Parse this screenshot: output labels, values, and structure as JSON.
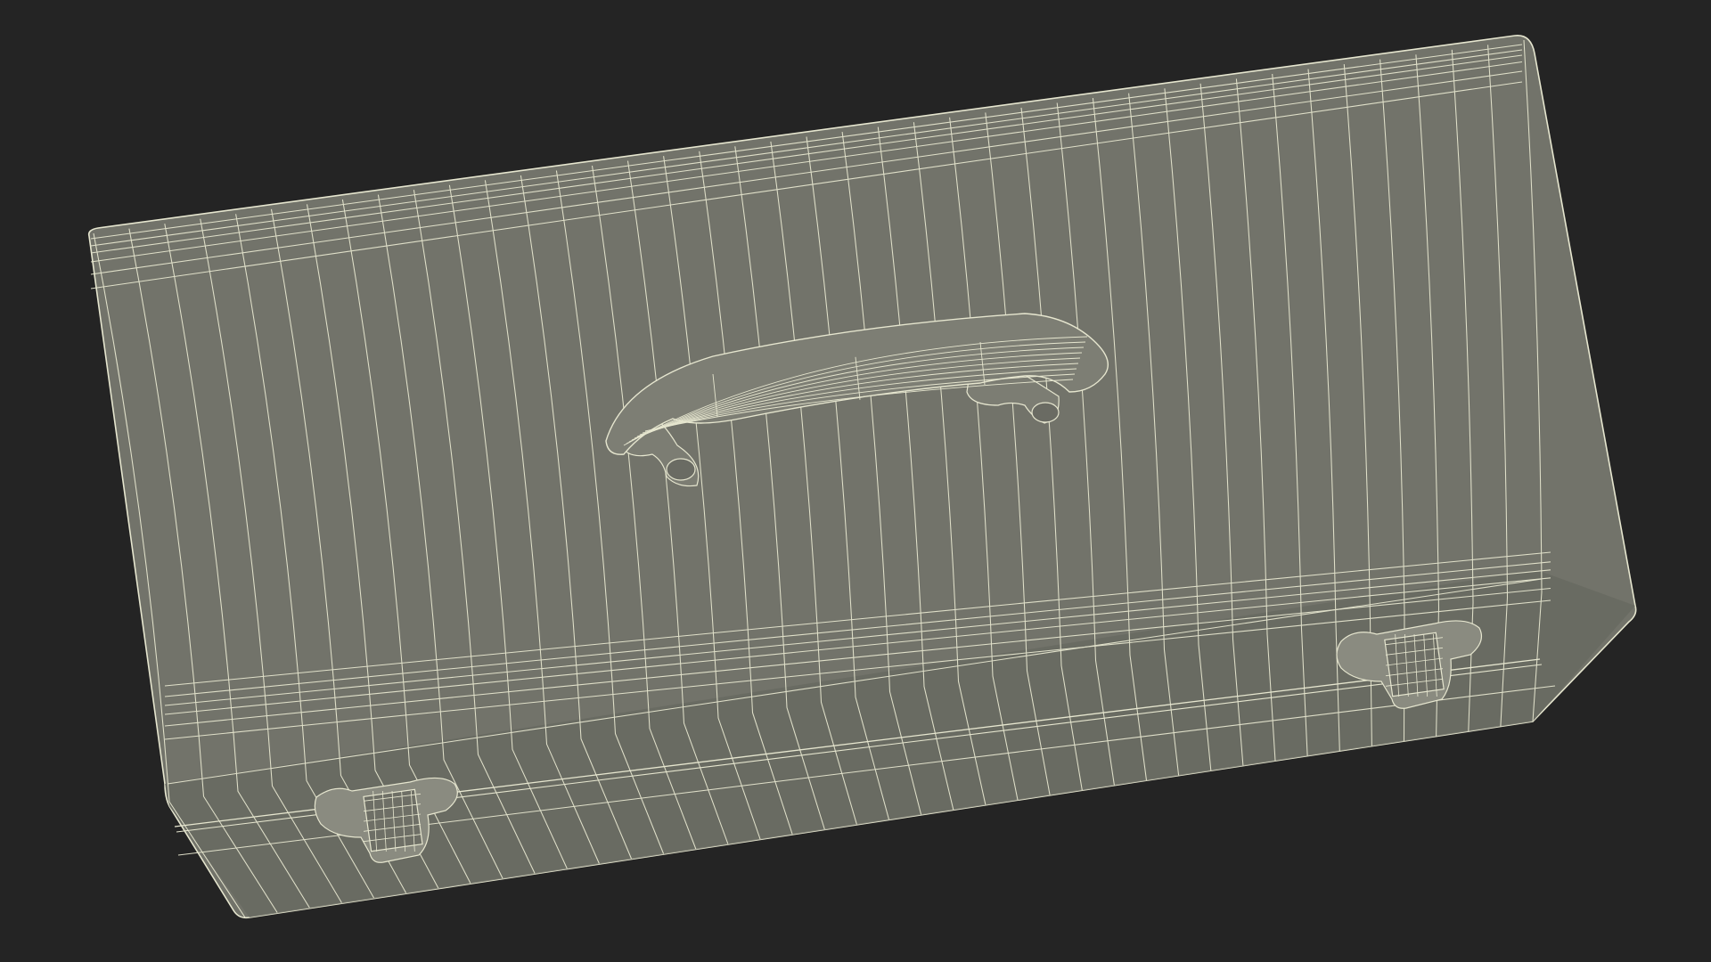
{
  "scene": {
    "subject": "wireframe-suitcase-render",
    "colors": {
      "background": "#242424",
      "surface": "#72736a",
      "surface_dark": "#5f6058",
      "surface_light": "#7c7d73",
      "wire": "#e6e6cf",
      "hardware": "#8a8b80"
    }
  }
}
